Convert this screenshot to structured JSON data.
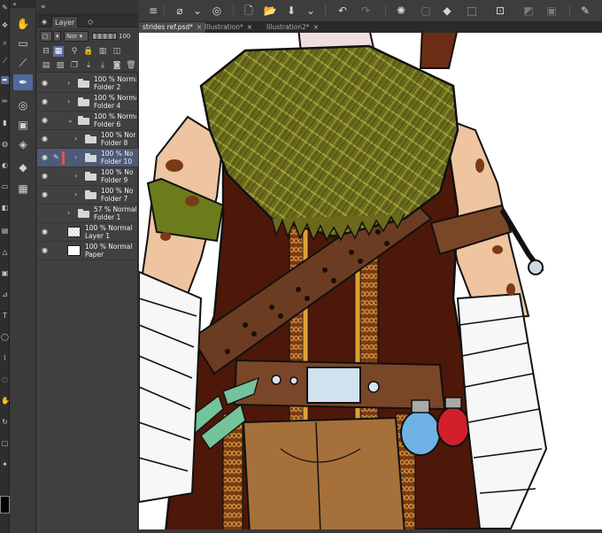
{
  "colors": {
    "accent": "#5a6d9a",
    "selected_layer": "#4d5b78",
    "panel_bg": "#414141",
    "canvas_bg": "#ffffff"
  },
  "layer_panel": {
    "tab_label": "Layer",
    "blend_mode": "Nor",
    "opacity_value": "100",
    "layers": [
      {
        "name": "Folder 2",
        "mode": "100 % Normal",
        "type": "folder",
        "visible": true,
        "expanded": false,
        "indent": 0,
        "selected": false
      },
      {
        "name": "Folder 4",
        "mode": "100 % Normal",
        "type": "folder",
        "visible": true,
        "expanded": false,
        "indent": 0,
        "selected": false
      },
      {
        "name": "Folder 6",
        "mode": "100 % Normal",
        "type": "folder",
        "visible": true,
        "expanded": true,
        "indent": 0,
        "selected": false
      },
      {
        "name": "Folder 8",
        "mode": "100 % Nor",
        "type": "folder",
        "visible": true,
        "expanded": false,
        "indent": 1,
        "selected": false
      },
      {
        "name": "Folder 10",
        "mode": "100 % No",
        "type": "folder",
        "visible": true,
        "expanded": false,
        "indent": 1,
        "selected": true
      },
      {
        "name": "Folder 9",
        "mode": "100 % No",
        "type": "folder",
        "visible": true,
        "expanded": false,
        "indent": 1,
        "selected": false
      },
      {
        "name": "Folder 7",
        "mode": "100 % No",
        "type": "folder",
        "visible": true,
        "expanded": false,
        "indent": 1,
        "selected": false
      },
      {
        "name": "Folder 1",
        "mode": "57 % Normal",
        "type": "folder",
        "visible": false,
        "expanded": false,
        "indent": 0,
        "selected": false
      },
      {
        "name": "Layer 1",
        "mode": "100 % Normal",
        "type": "raster",
        "visible": true,
        "expanded": false,
        "indent": -1,
        "selected": false
      },
      {
        "name": "Paper",
        "mode": "100 % Normal",
        "type": "paper",
        "visible": true,
        "expanded": false,
        "indent": -1,
        "selected": false
      }
    ]
  },
  "document_tabs": [
    {
      "label": "strides ref.psd*",
      "active": true
    },
    {
      "label": "Illustration*",
      "active": false
    },
    {
      "label": "Illustration2*",
      "active": false
    }
  ],
  "toolbar_icons": [
    "menu-icon",
    "brush-settings-icon",
    "chevron-down-icon",
    "layer-property-icon",
    "new-file-icon",
    "open-folder-icon",
    "save-icon",
    "chevron-down-icon",
    "undo-icon",
    "redo-icon",
    "loading-icon",
    "clear-icon",
    "fill-icon",
    "transform-icon",
    "crop-icon",
    "deselect-icon",
    "invert-selection-icon",
    "pen-icon"
  ]
}
